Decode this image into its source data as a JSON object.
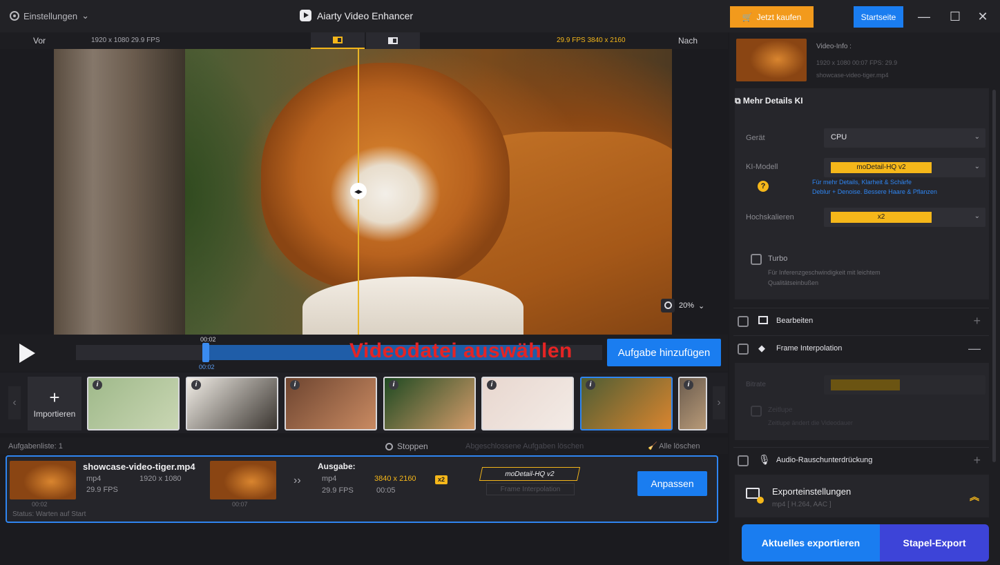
{
  "titlebar": {
    "settings_label": "Einstellungen",
    "app_title": "Aiarty Video Enhancer",
    "buy_label": "Jetzt kaufen",
    "home_label": "Startseite"
  },
  "preview": {
    "before_label": "Vor",
    "after_label": "Nach",
    "input_info": "1920 x 1080  29.9 FPS",
    "output_info": "29.9 FPS  3840 x 2160",
    "zoom_level": "20%",
    "split_handle": "◂▸"
  },
  "timeline": {
    "current_time": "00:02",
    "position_time": "00:02",
    "overlay_annotation": "Videodatei auswählen",
    "add_task_label": "Aufgabe hinzufügen"
  },
  "thumbnails": {
    "import_label": "Importieren",
    "items": [
      {
        "name": "hummingbird",
        "colors": [
          "#9fb98a",
          "#c9d6b3"
        ]
      },
      {
        "name": "cat",
        "colors": [
          "#f1ede6",
          "#3a3530"
        ]
      },
      {
        "name": "woman-portrait",
        "colors": [
          "#6e4530",
          "#c98a62"
        ]
      },
      {
        "name": "woman-leaves",
        "colors": [
          "#1f4a22",
          "#d39b6a"
        ]
      },
      {
        "name": "baby",
        "colors": [
          "#e8d7cf",
          "#f3ebe6"
        ]
      },
      {
        "name": "tiger",
        "colors": [
          "#4e5d34",
          "#d9852f"
        ]
      },
      {
        "name": "tree",
        "colors": [
          "#6b5c4e",
          "#b89a78"
        ]
      }
    ]
  },
  "tasklist": {
    "header_label": "Aufgabenliste:",
    "count": "1",
    "stop_label": "Stoppen",
    "clear_done_label": "Abgeschlossene Aufgaben löschen",
    "clear_all_label": "Alle löschen",
    "task": {
      "file_name": "showcase-video-tiger.mp4",
      "format": "mp4",
      "resolution": "1920 x 1080",
      "fps": "29.9 FPS",
      "thumb_time_start": "00:02",
      "thumb_time_end": "00:07",
      "output_label": "Ausgabe:",
      "out_format": "mp4",
      "out_resolution": "3840 x 2160",
      "scale_badge": "x2",
      "out_fps": "29.9 FPS",
      "out_duration": "00:05",
      "model_tag": "moDetail-HQ  v2",
      "frame_interp_tag": "Frame Interpolation",
      "adjust_label": "Anpassen",
      "status": "Status: Warten auf Start"
    }
  },
  "right_panel": {
    "video_info": {
      "title": "Video-Info :",
      "line1": "1920 x 1080  00:07   FPS: 29.9",
      "line2": "showcase-video-tiger.mp4"
    },
    "ai_section": {
      "title": "Mehr Details KI",
      "device_label": "Gerät",
      "device_value": "CPU",
      "model_label": "KI-Modell",
      "model_value": "moDetail-HQ  v2",
      "hint_line1": "Für mehr Details, Klarheit & Schärfe",
      "hint_line2": "Deblur + Denoise. Bessere Haare & Pflanzen",
      "upscale_label": "Hochskalieren",
      "upscale_value": "x2",
      "turbo_label": "Turbo",
      "turbo_desc1": "Für Inferenzgeschwindigkeit mit leichtem",
      "turbo_desc2": "Qualitätseinbußen"
    },
    "edit_label": "Bearbeiten",
    "frame_interp": {
      "label": "Frame Interpolation",
      "bitrate_label": "Bitrate",
      "timelapse_label": "Zeitlupe",
      "timelapse_desc": "Zeitlupe ändert die Videodauer"
    },
    "audio_label": "Audio-Rauschunterdrückung",
    "export_settings": {
      "title": "Exporteinstellungen",
      "subtitle": "mp4 [ H.264, AAC ]"
    },
    "export_current_label": "Aktuelles exportieren",
    "export_batch_label": "Stapel-Export"
  },
  "colors": {
    "accent_blue": "#1a7df0",
    "accent_orange": "#f29a1c",
    "accent_yellow": "#f5b71a",
    "batch_purple": "#3d44d8",
    "annotation_red": "#e52424"
  }
}
